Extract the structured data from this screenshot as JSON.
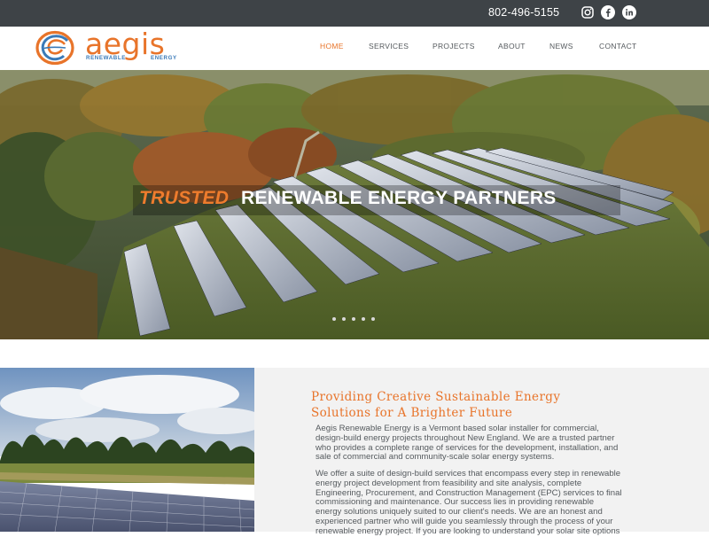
{
  "topbar": {
    "phone": "802-496-5155",
    "social_icons": [
      "instagram-icon",
      "facebook-icon",
      "linkedin-icon"
    ],
    "background": "#3e4347"
  },
  "brand": {
    "name": "aegis",
    "tagline_left": "RENEWABLE",
    "tagline_right": "ENERGY",
    "accent": "#e8742a",
    "secondary": "#3a7ab8"
  },
  "nav": {
    "items": [
      "HOME",
      "SERVICES",
      "PROJECTS",
      "ABOUT",
      "NEWS",
      "CONTACT"
    ],
    "active": "HOME"
  },
  "hero": {
    "title_highlight": "TRUSTED",
    "title_rest": "RENEWABLE ENERGY PARTNERS",
    "slide_count": 5,
    "active_slide": 1
  },
  "intro": {
    "heading_line1": "Providing Creative Sustainable Energy",
    "heading_line2": "Solutions for A Brighter Future",
    "paragraph1_lines": [
      "Aegis Renewable Energy is a Vermont based solar installer for commercial,",
      "design-build energy projects throughout New England. We are a trusted partner",
      "who provides a complete range of services for the development, installation, and",
      "sale of commercial and community-scale solar energy systems."
    ],
    "paragraph2_lines": [
      "We offer a suite of design-build services that encompass every step in renewable",
      "energy project development from feasibility and site analysis, complete",
      "Engineering, Procurement, and Construction Management (EPC) services to final",
      "commissioning and maintenance. Our success lies in providing renewable",
      "energy solutions uniquely suited to our client's needs. We are an honest and",
      "experienced partner who will guide you seamlessly through the process of your",
      "renewable energy project. If you are looking to understand your solar site options"
    ]
  }
}
